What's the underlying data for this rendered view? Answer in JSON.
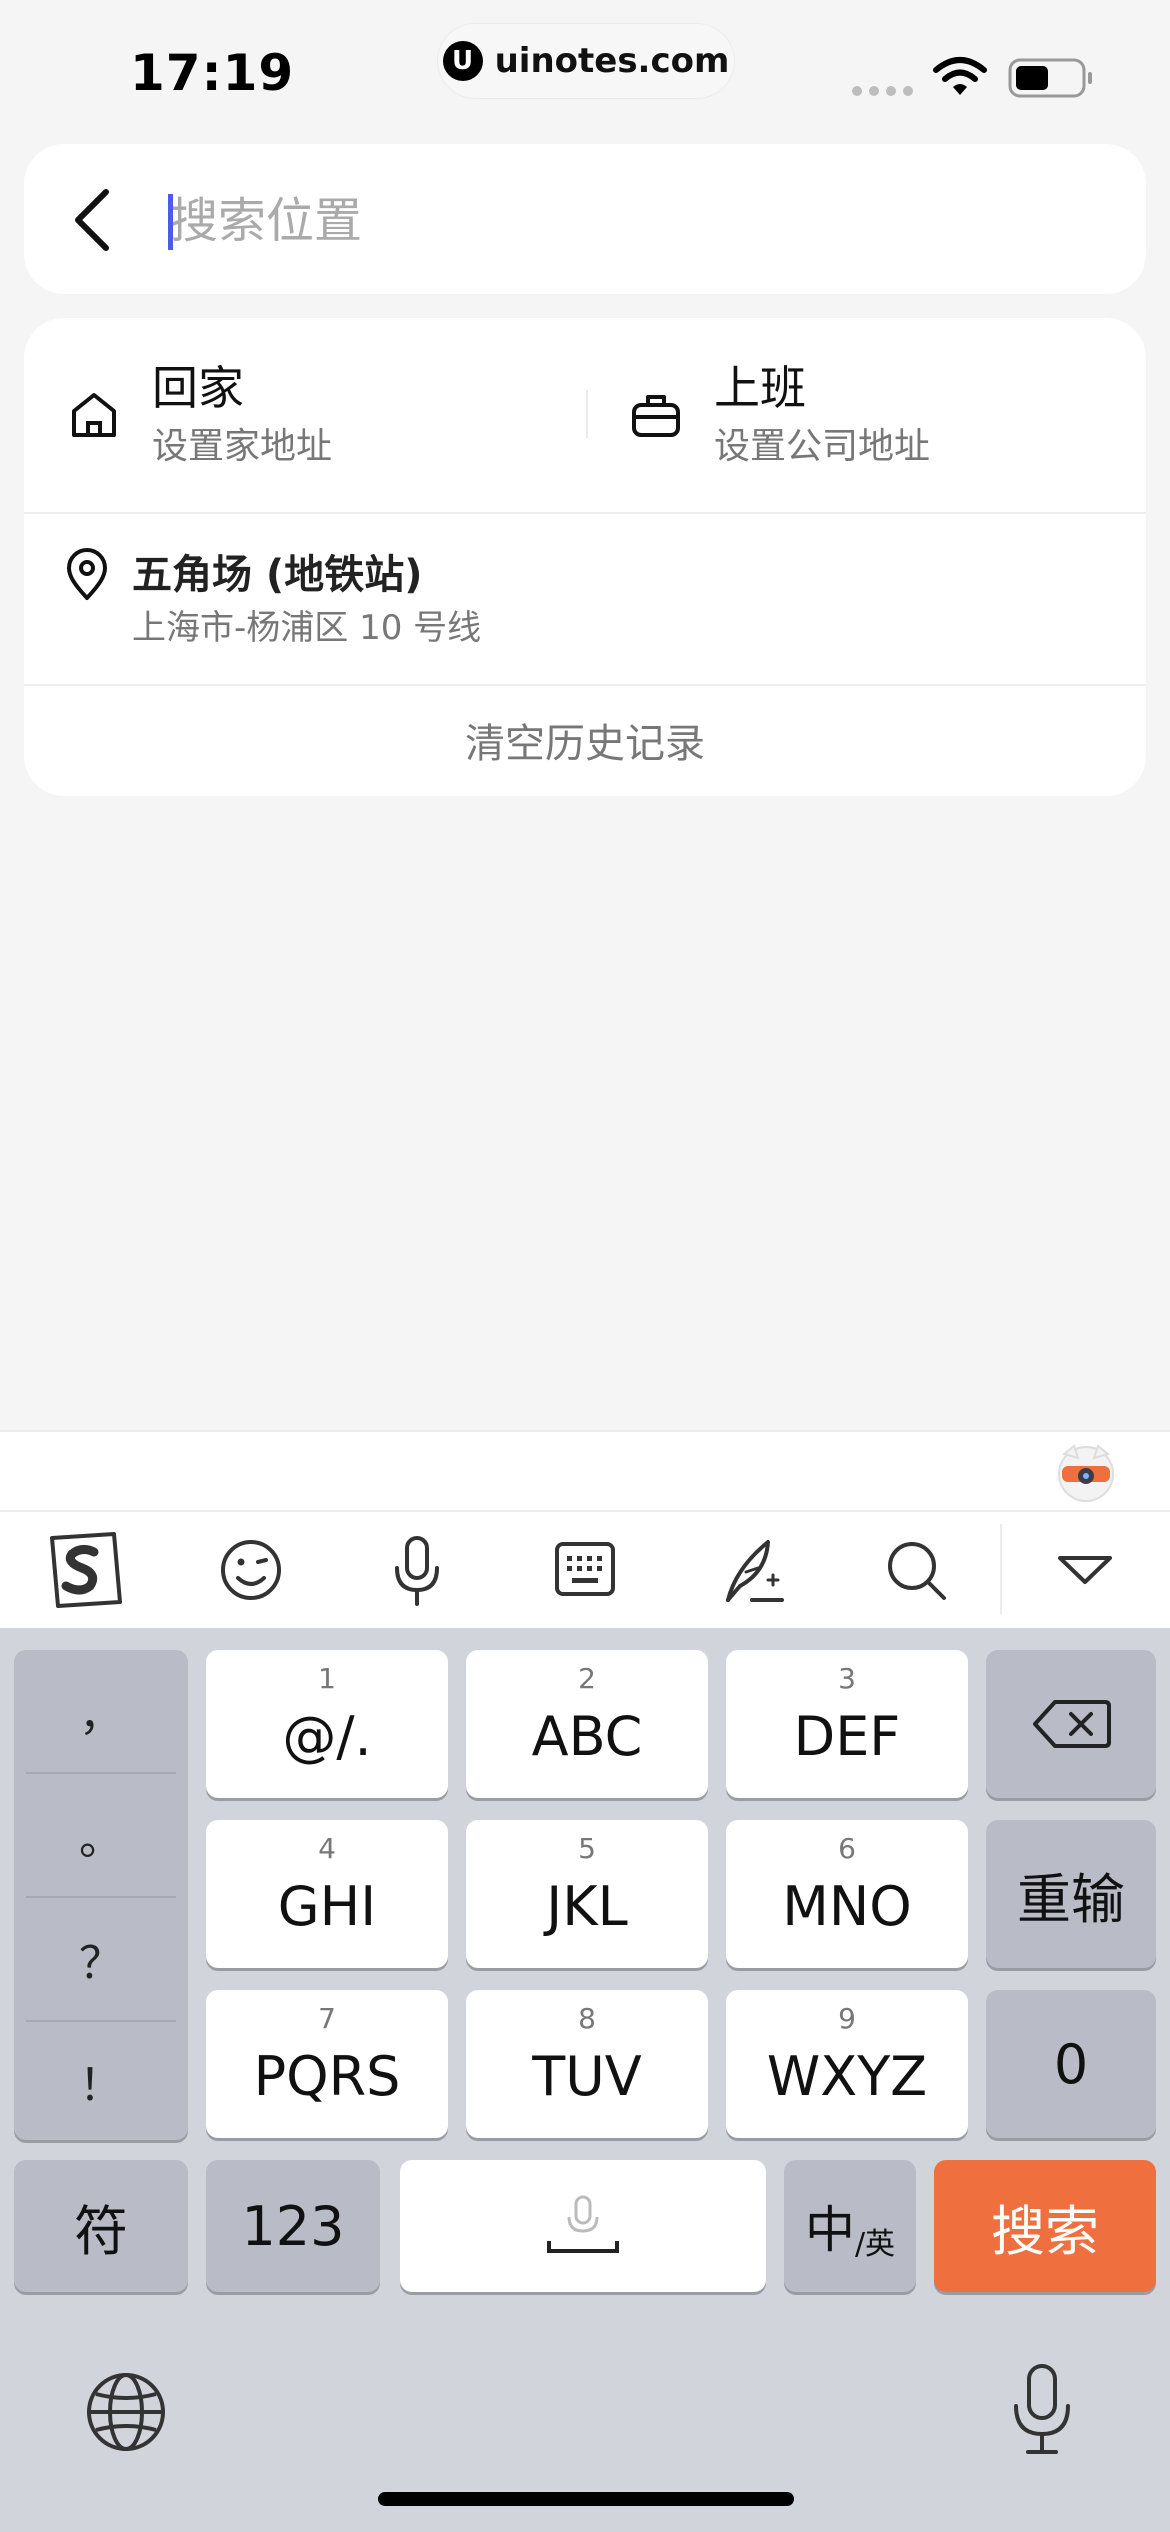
{
  "status": {
    "time": "17:19",
    "url": "uinotes.com",
    "url_logo_letter": "U"
  },
  "search": {
    "placeholder": "搜索位置",
    "value": ""
  },
  "shortcuts": [
    {
      "title": "回家",
      "subtitle": "设置家地址",
      "icon": "home-icon"
    },
    {
      "title": "上班",
      "subtitle": "设置公司地址",
      "icon": "briefcase-icon"
    }
  ],
  "history": [
    {
      "name": "五角场 (地铁站)",
      "address": "上海市-杨浦区 10 号线",
      "icon": "location-pin-icon"
    }
  ],
  "clear_history": "清空历史记录",
  "keyboard": {
    "toolbar_icons": [
      "sogou-logo-icon",
      "emoji-icon",
      "microphone-icon",
      "keyboard-icon",
      "handwriting-icon",
      "search-icon",
      "collapse-keyboard-icon"
    ],
    "punctuation": [
      "，",
      "。",
      "？",
      "！"
    ],
    "keys": [
      {
        "num": "1",
        "label": "@/."
      },
      {
        "num": "2",
        "label": "ABC"
      },
      {
        "num": "3",
        "label": "DEF"
      },
      {
        "num": "4",
        "label": "GHI"
      },
      {
        "num": "5",
        "label": "JKL"
      },
      {
        "num": "6",
        "label": "MNO"
      },
      {
        "num": "7",
        "label": "PQRS"
      },
      {
        "num": "8",
        "label": "TUV"
      },
      {
        "num": "9",
        "label": "WXYZ"
      }
    ],
    "reenter": "重输",
    "zero": "0",
    "symbols": "符",
    "numbers": "123",
    "lang_main": "中",
    "lang_sub": "/英",
    "search_key": "搜索",
    "accent_color": "#ef6f3f"
  }
}
